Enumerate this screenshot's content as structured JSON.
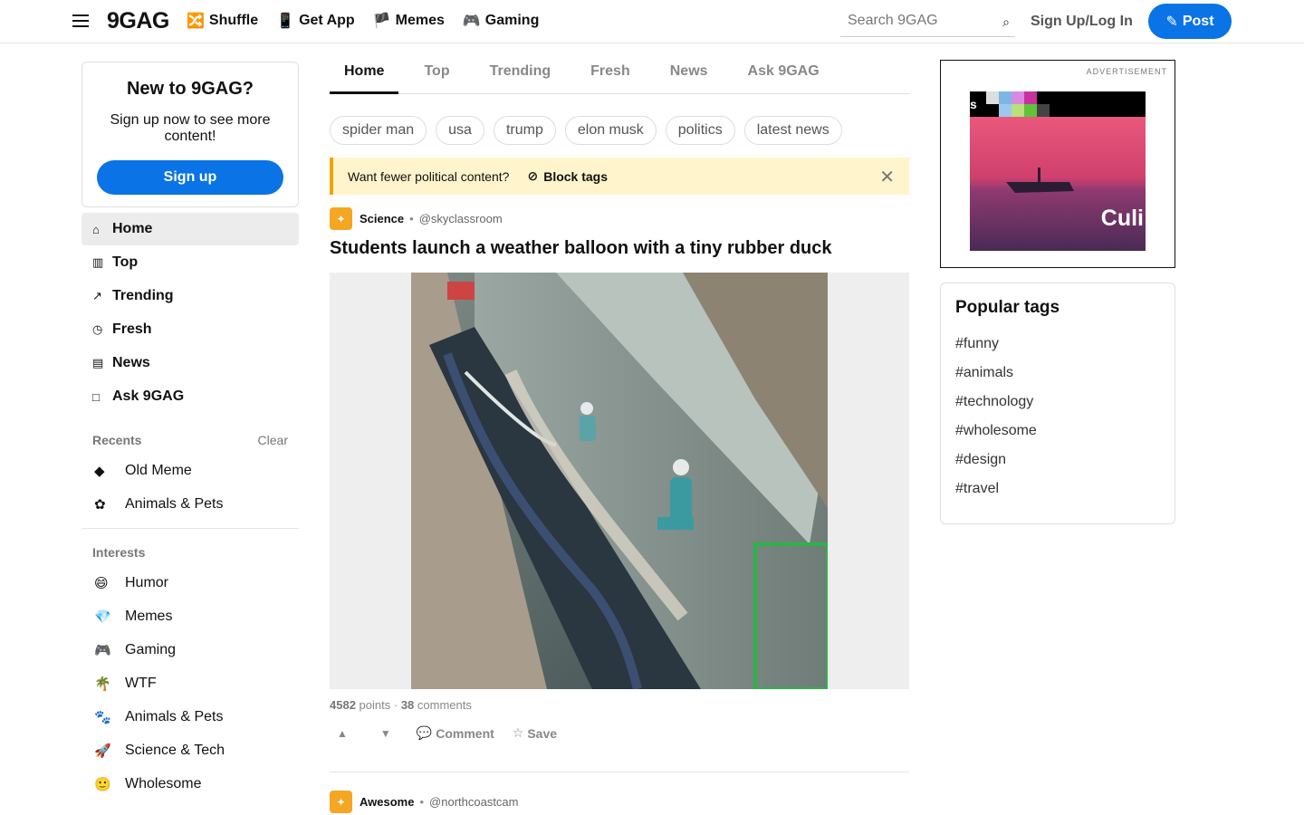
{
  "header": {
    "logo": "9GAG",
    "nav": [
      {
        "icon": "🔀",
        "label": "Shuffle"
      },
      {
        "icon": "📱",
        "label": "Get App"
      },
      {
        "icon": "🏴",
        "label": "Memes"
      },
      {
        "icon": "🎮",
        "label": "Gaming"
      }
    ],
    "search_placeholder": "Search 9GAG",
    "signin_label": "Sign Up/Log In",
    "post_label": "Post"
  },
  "signup_card": {
    "title": "New to 9GAG?",
    "text": "Sign up now to see more content!",
    "button": "Sign up"
  },
  "leftnav": [
    {
      "icon": "⌂",
      "label": "Home",
      "active": true
    },
    {
      "icon": "▥",
      "label": "Top"
    },
    {
      "icon": "↗",
      "label": "Trending"
    },
    {
      "icon": "◷",
      "label": "Fresh"
    },
    {
      "icon": "▤",
      "label": "News"
    },
    {
      "icon": "□",
      "label": "Ask 9GAG"
    }
  ],
  "recents": {
    "heading": "Recents",
    "clear": "Clear",
    "items": [
      {
        "icon": "◆",
        "label": "Old Meme"
      },
      {
        "icon": "✿",
        "label": "Animals & Pets"
      }
    ]
  },
  "interests": {
    "heading": "Interests",
    "items": [
      {
        "icon": "😄",
        "label": "Humor"
      },
      {
        "icon": "💎",
        "label": "Memes"
      },
      {
        "icon": "🎮",
        "label": "Gaming"
      },
      {
        "icon": "🌴",
        "label": "WTF"
      },
      {
        "icon": "🐾",
        "label": "Animals & Pets"
      },
      {
        "icon": "🚀",
        "label": "Science & Tech"
      },
      {
        "icon": "🙂",
        "label": "Wholesome"
      }
    ]
  },
  "tabs": [
    "Home",
    "Top",
    "Trending",
    "Fresh",
    "News",
    "Ask 9GAG"
  ],
  "chips": [
    "spider man",
    "usa",
    "trump",
    "elon musk",
    "politics",
    "latest news"
  ],
  "banner": {
    "text": "Want fewer political content?",
    "block_label": "Block tags"
  },
  "post": {
    "section": "Science",
    "handle": "@skyclassroom",
    "title": "Students launch a weather balloon with a tiny rubber duck",
    "points": "4582",
    "points_label": "points",
    "comments": "38",
    "comments_label": "comments",
    "comment_label": "Comment",
    "save_label": "Save"
  },
  "next_post": {
    "section": "Awesome",
    "handle": "@northcoastcam"
  },
  "ad": {
    "label": "ADVERTISEMENT",
    "word": "Culi",
    "letter": "s"
  },
  "popular_tags": {
    "title": "Popular tags",
    "tags": [
      "#funny",
      "#animals",
      "#technology",
      "#wholesome",
      "#design",
      "#travel"
    ]
  },
  "colors": {
    "accent": "#0a73e6",
    "banner_bg": "#fff4cc",
    "badge": "#f5a623"
  }
}
